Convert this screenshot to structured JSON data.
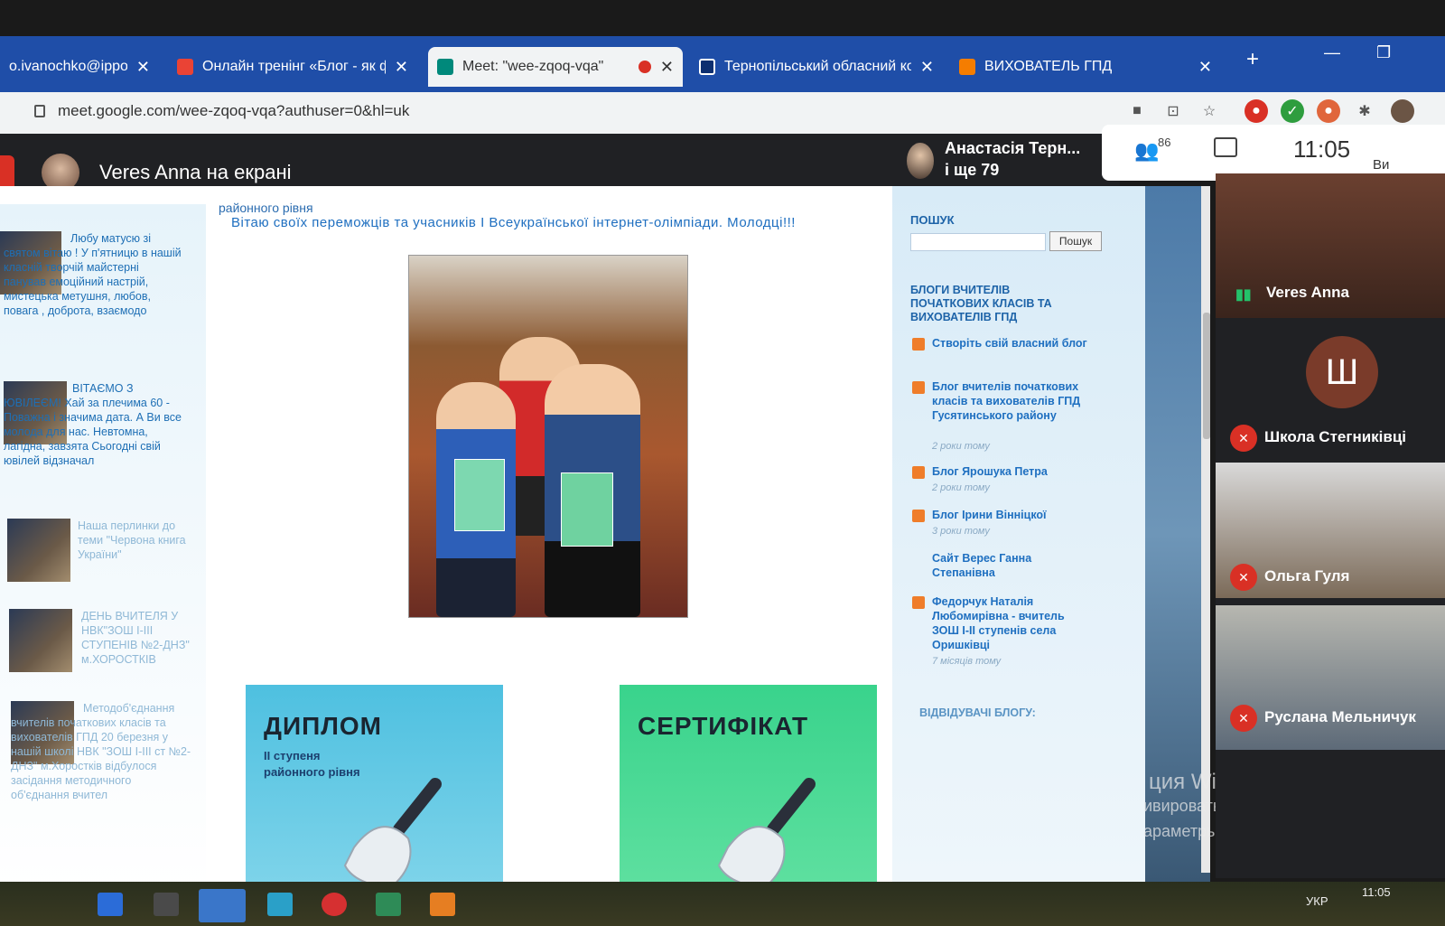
{
  "browser": {
    "tabs": [
      {
        "title": "o.ivanochko@ippo.ed",
        "icon": "mail-icon",
        "color": "#d93025",
        "active": false
      },
      {
        "title": "Онлайн тренінг «Блог - як фо",
        "icon": "gmail-icon",
        "color": "#ea4335",
        "active": false
      },
      {
        "title": "Meet: \"wee-zqoq-vqa\"",
        "icon": "meet-icon",
        "color": "#00897b",
        "active": true
      },
      {
        "title": "Тернопільський обласний ко",
        "icon": "site-icon",
        "color": "#1a4c9a",
        "active": false
      },
      {
        "title": "ВИХОВАТЕЛЬ ГПД",
        "icon": "blogger-icon",
        "color": "#f57d00",
        "active": false
      }
    ],
    "close_glyph": "✕",
    "new_tab_glyph": "+",
    "url": "meet.google.com/wee-zqoq-vqa?authuser=0&hl=uk"
  },
  "meet": {
    "presenter_label": "Veres Anna на екрані",
    "speaker_name": "Анастасія Терн...",
    "speaker_more": "і ще 79",
    "people_count": "86",
    "clock": "11:05",
    "self_label": "Ви",
    "participants": [
      {
        "name": "Veres Anna",
        "muted": false
      },
      {
        "name": "Школа Стегниківці",
        "muted": true,
        "initial": "Ш"
      },
      {
        "name": "Ольга Гуля",
        "muted": true
      },
      {
        "name": "Руслана Мельничук",
        "muted": true
      }
    ]
  },
  "blog": {
    "cut_top": "районного рівня",
    "greeting": "Вітаю своїх переможців та учасників І Всеукраїнської інтернет-олімпіади. Молодці!!!",
    "left_posts": [
      {
        "text": "Любу матусю зі святом вітаю ! У п'ятницю в нашій класній творчій майстерні панував емоційний настрій, мистецька метушня, любов, повага , доброта, взаємодо"
      },
      {
        "text": "ВІТАЄМО З ЮВІЛЕЄМ! Хай за плечима 60 - Поважна і значима дата. А Ви все молода для нас. Невтомна, лагідна, завзята Сьогодні свій ювілей відзначал"
      },
      {
        "text": "Наша перлинки до теми \"Червона книга України\""
      },
      {
        "text": "ДЕНЬ ВЧИТЕЛЯ У НВК\"ЗОШ І-ІІІ СТУПЕНІВ №2-ДНЗ\" м.ХОРОСТКІВ"
      },
      {
        "text": "Методоб'єднання вчителів початкових класів та вихователів ГПД 20 березня у нашій школі НВК \"ЗОШ І-ІІІ ст №2-ДНЗ\" м.Хоростків відбулося засідання методичного об'єднання вчител"
      }
    ],
    "diploma": {
      "heading": "ДИПЛОМ",
      "sub": "ІІ ступеня районного рівня"
    },
    "certificate": {
      "heading": "СЕРТИФІКАТ"
    },
    "sidebar": {
      "search_title": "ПОШУК",
      "search_button": "Пошук",
      "blogs_title": "БЛОГИ ВЧИТЕЛІВ ПОЧАТКОВИХ КЛАСІВ ТА ВИХОВАТЕЛІВ ГПД",
      "items": [
        {
          "title": "Створіть свій власний блог",
          "age": ""
        },
        {
          "title": "Блог вчителів початкових класів та вихователів ГПД Гусятинського району",
          "age": "2 роки тому"
        },
        {
          "title": "Блог Ярошука Петра",
          "age": "2 роки тому"
        },
        {
          "title": "Блог Ірини Вінніцкої",
          "age": "3 роки тому"
        },
        {
          "title": "Сайт Верес Ганна Степанівна",
          "age": ""
        },
        {
          "title": "Федорчук Наталія Любомирівна - вчитель ЗОШ І-ІІ ступенів села Оришківці",
          "age": "7 місяців тому"
        }
      ],
      "visitors_title": "ВІДВІДУВАЧІ БЛОГУ:"
    }
  },
  "windows_watermark": {
    "line1": "ция Windows",
    "line2": "ивировать Windows, перейдите в",
    "line3": "араметры\"."
  },
  "taskbar": {
    "lang": "УКР",
    "time": "11:05"
  }
}
